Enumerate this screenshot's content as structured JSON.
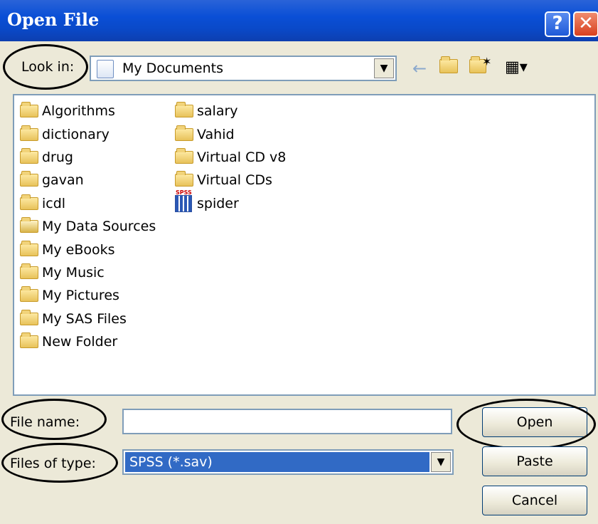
{
  "window": {
    "title": "Open File",
    "help_label": "?",
    "close_label": "✕"
  },
  "look_in": {
    "label": "Look in:",
    "value": "My Documents",
    "icon": "my-documents-icon"
  },
  "toolbar": {
    "back_icon": "←",
    "up_folder_icon": "⬆",
    "new_folder_icon": "✶",
    "views_icon": "▦▾"
  },
  "files": {
    "column1": [
      {
        "name": "Algorithms",
        "icon": "folder"
      },
      {
        "name": "dictionary",
        "icon": "folder"
      },
      {
        "name": "drug",
        "icon": "folder"
      },
      {
        "name": "gavan",
        "icon": "folder"
      },
      {
        "name": "icdl",
        "icon": "folder"
      },
      {
        "name": "My Data Sources",
        "icon": "data-sources"
      },
      {
        "name": "My eBooks",
        "icon": "folder"
      },
      {
        "name": "My Music",
        "icon": "music-folder"
      },
      {
        "name": "My Pictures",
        "icon": "pictures-folder"
      },
      {
        "name": "My SAS Files",
        "icon": "folder"
      },
      {
        "name": "New Folder",
        "icon": "folder"
      }
    ],
    "column2": [
      {
        "name": "salary",
        "icon": "folder"
      },
      {
        "name": "Vahid",
        "icon": "folder"
      },
      {
        "name": "Virtual CD v8",
        "icon": "folder"
      },
      {
        "name": "Virtual CDs",
        "icon": "folder"
      },
      {
        "name": "spider",
        "icon": "spss-file"
      }
    ]
  },
  "file_name": {
    "label": "File name:",
    "value": ""
  },
  "file_type": {
    "label": "Files of type:",
    "value": "SPSS (*.sav)"
  },
  "buttons": {
    "open": "Open",
    "paste": "Paste",
    "cancel": "Cancel"
  },
  "arrow": "▼"
}
